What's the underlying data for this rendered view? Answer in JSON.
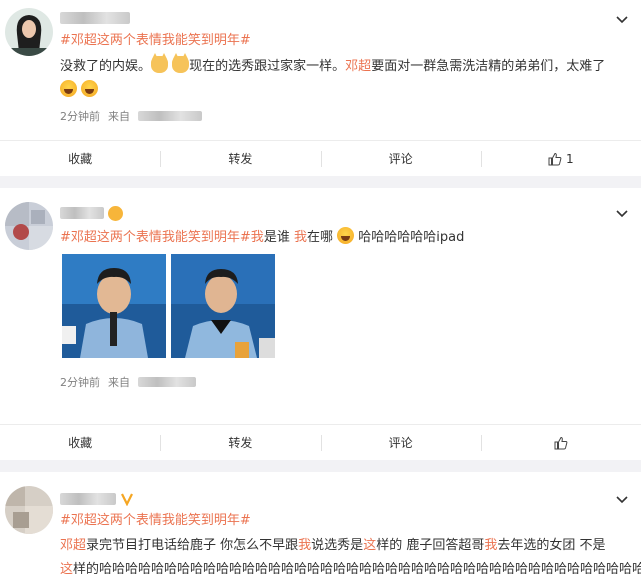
{
  "posts": [
    {
      "topic": "#邓超这两个表情我能笑到明年#",
      "line1": {
        "a": "没救了的内娱。",
        "b": "现在的选秀跟过家家一样。",
        "hl": "邓超",
        "c": "要面对一群急需洗洁精的弟弟们，太难了"
      },
      "time": "2分钟前",
      "from": "来自",
      "actions": {
        "collect": "收藏",
        "repost": "转发",
        "comment": "评论",
        "like_count": "1"
      }
    },
    {
      "topic": "#邓超这两个表情我能笑到明年#",
      "text": {
        "a": "我",
        "b": "是谁 ",
        "c": "我",
        "d": "在哪",
        "e": "哈哈哈哈哈哈ipad"
      },
      "time": "2分钟前",
      "from": "来自",
      "actions": {
        "collect": "收藏",
        "repost": "转发",
        "comment": "评论"
      }
    },
    {
      "topic": "#邓超这两个表情我能笑到明年#",
      "line1": {
        "a": "邓超",
        "b": "录完节目打电话给鹿子 你怎么不早跟",
        "c": "我",
        "d": "说选秀是",
        "e": "这",
        "f": "样的 鹿子回答超哥",
        "g": "我",
        "h": "去年选的女团 不是"
      },
      "line2": {
        "a": "这",
        "b": "样的哈哈哈哈哈哈哈哈哈哈哈哈哈哈哈哈哈哈哈哈哈哈哈哈哈哈哈哈哈哈哈哈哈哈哈哈哈哈哈哈哈哈哈"
      }
    }
  ],
  "icons": {
    "chevron": "chevron-down-icon",
    "like": "thumbs-up-icon",
    "verified": "v-badge-icon",
    "emoji_cat": "cat-emoji-icon",
    "emoji_laugh": "laugh-emoji-icon"
  },
  "colors": {
    "accent": "#eb7350",
    "meta": "#808080"
  }
}
